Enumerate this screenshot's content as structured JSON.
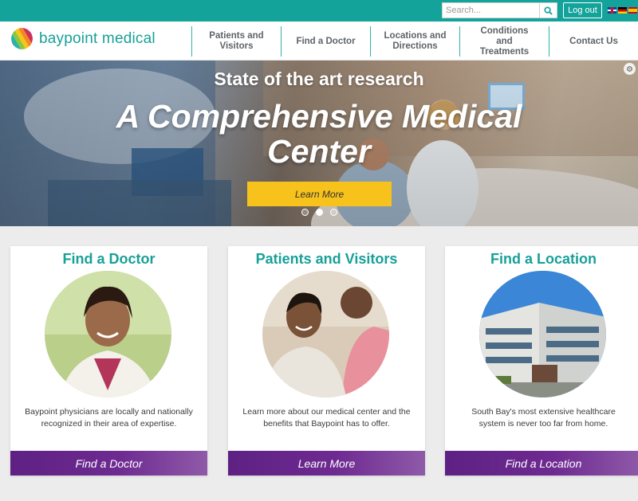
{
  "brand": {
    "name": "baypoint medical",
    "color": "#17a098"
  },
  "utility": {
    "search_placeholder": "Search...",
    "logout_label": "Log out",
    "languages": [
      "English",
      "Deutsch",
      "Español"
    ]
  },
  "nav": {
    "items": [
      {
        "label": "Patients and Visitors"
      },
      {
        "label": "Find a Doctor"
      },
      {
        "label": "Locations and Directions"
      },
      {
        "label": "Conditions and Treatments"
      },
      {
        "label": "Contact Us"
      }
    ]
  },
  "hero": {
    "kicker": "State of the art research",
    "title": "A Comprehensive Medical Center",
    "button_label": "Learn More",
    "slide_count": 3,
    "active_slide": 2
  },
  "cards": [
    {
      "title": "Find a Doctor",
      "description": "Baypoint physicians are locally and nationally recognized in their area of expertise.",
      "button_label": "Find a Doctor"
    },
    {
      "title": "Patients and Visitors",
      "description": "Learn more about our medical center and the benefits that Baypoint has to offer.",
      "button_label": "Learn More"
    },
    {
      "title": "Find a Location",
      "description": "South Bay's most extensive healthcare system is never too far from home.",
      "button_label": "Find a Location"
    }
  ],
  "colors": {
    "teal": "#14a39a",
    "purple": "#5e2183",
    "yellow": "#f7c21b"
  }
}
